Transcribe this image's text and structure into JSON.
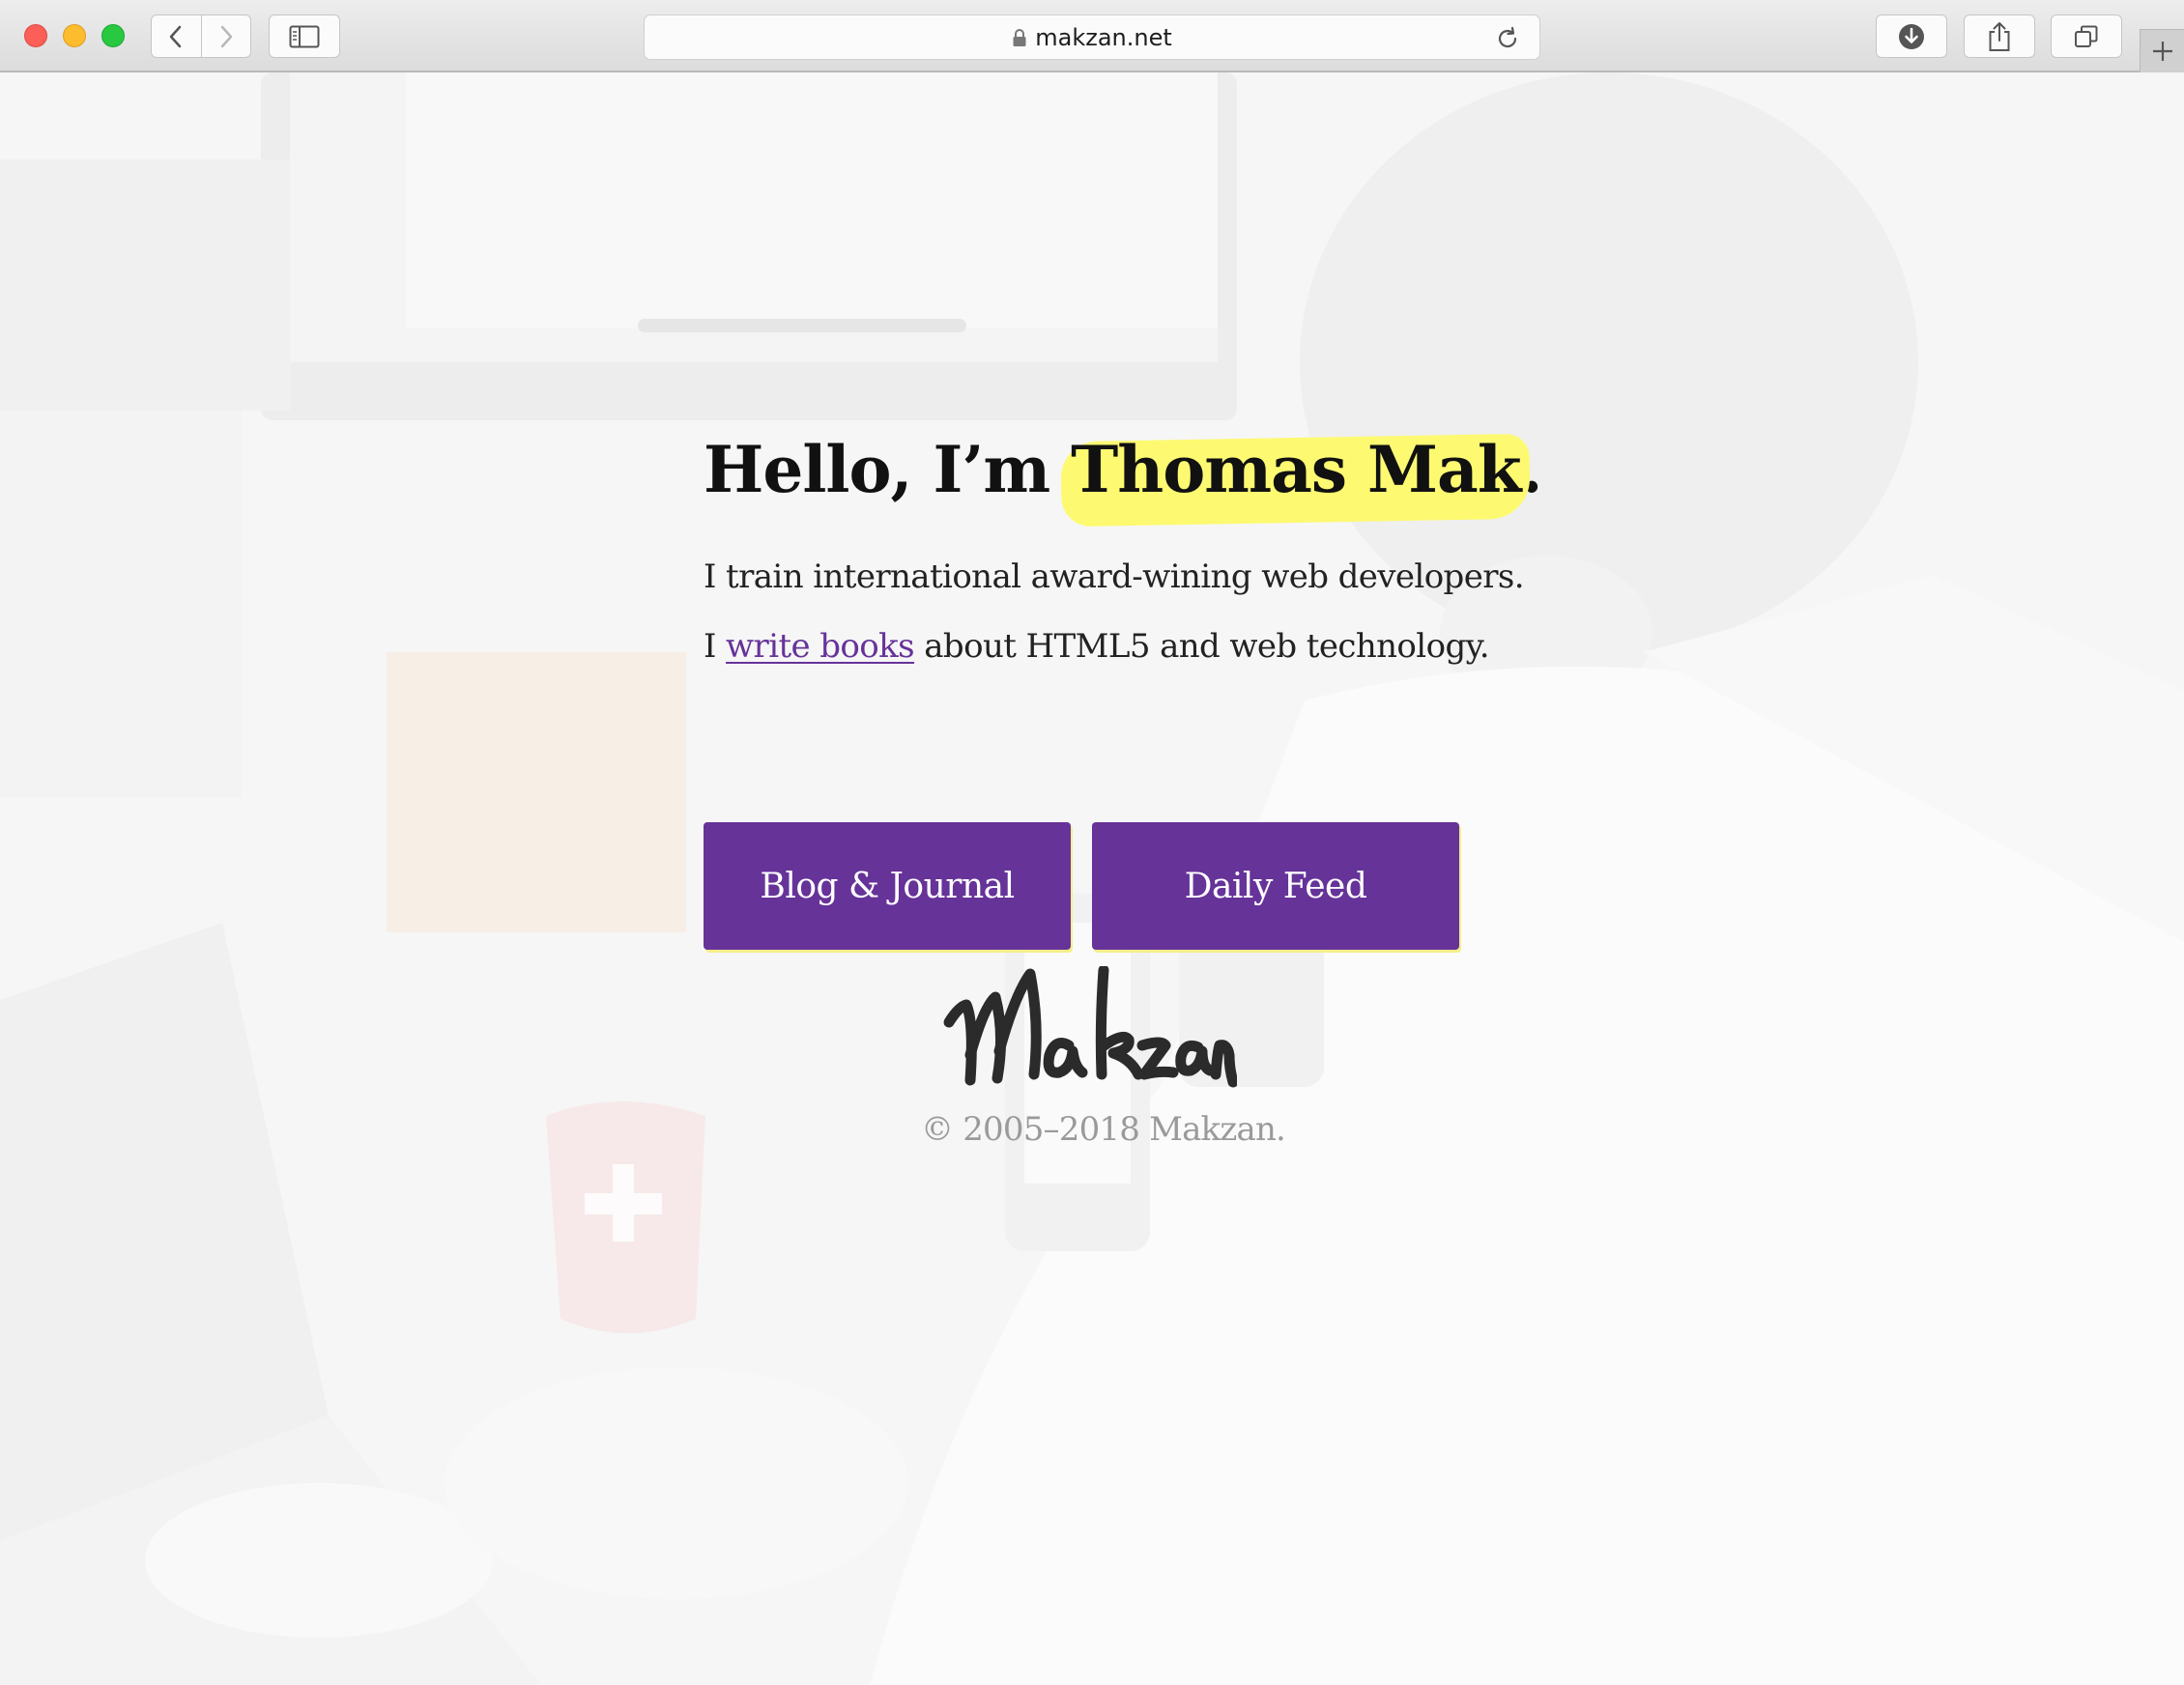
{
  "browser": {
    "url": "makzan.net",
    "icons": {
      "close": "close-dot",
      "minimize": "minimize-dot",
      "zoom": "zoom-dot",
      "back": "chevron-left-icon",
      "forward": "chevron-right-icon",
      "sidebar": "sidebar-icon",
      "lock": "lock-icon",
      "reload": "reload-icon",
      "downloads": "download-icon",
      "share": "share-icon",
      "tabs": "tabs-icon",
      "new_tab": "plus-icon"
    }
  },
  "hero": {
    "greeting": "Hello, I’m ",
    "name": "Thomas Mak",
    "name_suffix": ".",
    "line1": "I train international award-wining web developers.",
    "line2_prefix": "I ",
    "line2_link": "write books",
    "line2_suffix": " about HTML5 and web technology."
  },
  "buttons": {
    "blog": "Blog & Journal",
    "daily": "Daily Feed"
  },
  "footer": {
    "signature": "Makzan",
    "copyright": "© 2005–2018 Makzan."
  },
  "colors": {
    "accent": "#663399",
    "highlight": "#fdfa72",
    "muted_text": "#9a9a9a"
  }
}
